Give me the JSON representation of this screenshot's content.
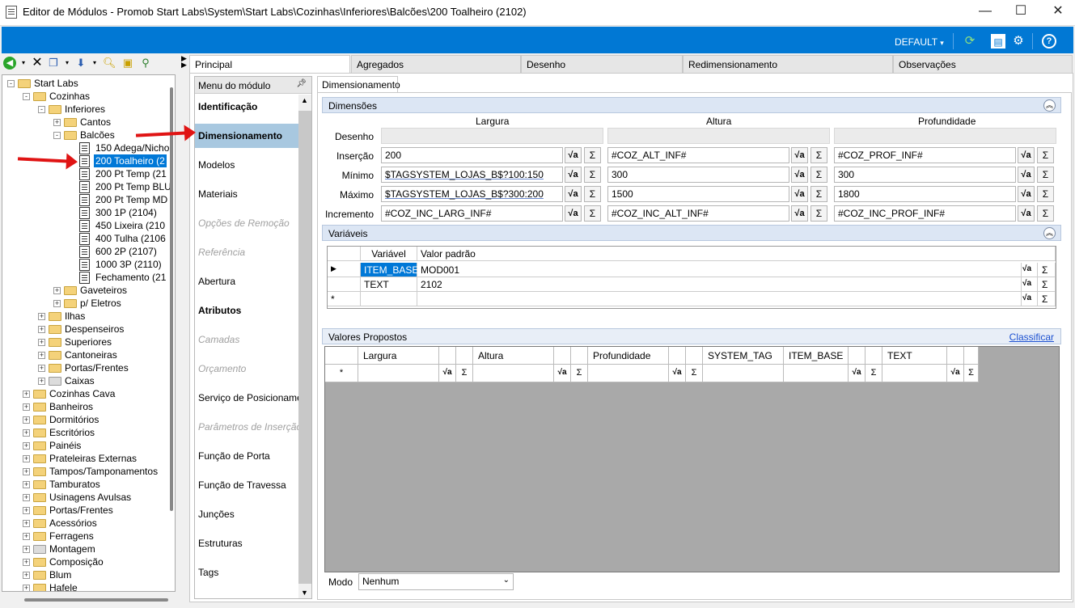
{
  "window": {
    "title": "Editor de Módulos - Promob Start Labs\\System\\Start Labs\\Cozinhas\\Inferiores\\Balcões\\200 Toalheiro (2102)",
    "minimize": "—",
    "maximize": "☐",
    "close": "✕"
  },
  "toolbar": {
    "profile_label": "DEFAULT",
    "profile_caret": "▾",
    "icons": [
      "refresh-icon",
      "panel-icon",
      "gears-icon",
      "help-icon"
    ]
  },
  "left_toolbar": {
    "icons": [
      "back-icon",
      "delete-icon",
      "copy-icon",
      "move-down-icon",
      "find-icon",
      "tree-icon"
    ]
  },
  "tree": {
    "items": [
      {
        "label": "Start Labs",
        "level": 0,
        "expander": "-",
        "kind": "folder"
      },
      {
        "label": "Cozinhas",
        "level": 1,
        "expander": "-",
        "kind": "folder"
      },
      {
        "label": "Inferiores",
        "level": 2,
        "expander": "-",
        "kind": "folder"
      },
      {
        "label": "Cantos",
        "level": 3,
        "expander": "+",
        "kind": "folder"
      },
      {
        "label": "Balcões",
        "level": 3,
        "expander": "-",
        "kind": "folder"
      },
      {
        "label": "150 Adega/Nicho",
        "level": 4,
        "expander": "",
        "kind": "doc"
      },
      {
        "label": "200 Toalheiro (2",
        "level": 4,
        "expander": "",
        "kind": "doc",
        "selected": true
      },
      {
        "label": "200 Pt Temp (21",
        "level": 4,
        "expander": "",
        "kind": "doc"
      },
      {
        "label": "200 Pt Temp BLU",
        "level": 4,
        "expander": "",
        "kind": "doc"
      },
      {
        "label": "200 Pt Temp MD",
        "level": 4,
        "expander": "",
        "kind": "doc"
      },
      {
        "label": "300 1P (2104)",
        "level": 4,
        "expander": "",
        "kind": "doc"
      },
      {
        "label": "450 Lixeira (210",
        "level": 4,
        "expander": "",
        "kind": "doc"
      },
      {
        "label": "400 Tulha (2106",
        "level": 4,
        "expander": "",
        "kind": "doc"
      },
      {
        "label": "600 2P (2107)",
        "level": 4,
        "expander": "",
        "kind": "doc"
      },
      {
        "label": "1000 3P (2110)",
        "level": 4,
        "expander": "",
        "kind": "doc"
      },
      {
        "label": "Fechamento (21",
        "level": 4,
        "expander": "",
        "kind": "doc"
      },
      {
        "label": "Gaveteiros",
        "level": 3,
        "expander": "+",
        "kind": "folder"
      },
      {
        "label": "p/ Eletros",
        "level": 3,
        "expander": "+",
        "kind": "folder"
      },
      {
        "label": "Ilhas",
        "level": 2,
        "expander": "+",
        "kind": "folder"
      },
      {
        "label": "Despenseiros",
        "level": 2,
        "expander": "+",
        "kind": "folder"
      },
      {
        "label": "Superiores",
        "level": 2,
        "expander": "+",
        "kind": "folder"
      },
      {
        "label": "Cantoneiras",
        "level": 2,
        "expander": "+",
        "kind": "folder"
      },
      {
        "label": "Portas/Frentes",
        "level": 2,
        "expander": "+",
        "kind": "folder"
      },
      {
        "label": "Caixas",
        "level": 2,
        "expander": "+",
        "kind": "folder-gray"
      },
      {
        "label": "Cozinhas Cava",
        "level": 1,
        "expander": "+",
        "kind": "folder"
      },
      {
        "label": "Banheiros",
        "level": 1,
        "expander": "+",
        "kind": "folder"
      },
      {
        "label": "Dormitórios",
        "level": 1,
        "expander": "+",
        "kind": "folder"
      },
      {
        "label": "Escritórios",
        "level": 1,
        "expander": "+",
        "kind": "folder"
      },
      {
        "label": "Painéis",
        "level": 1,
        "expander": "+",
        "kind": "folder"
      },
      {
        "label": "Prateleiras Externas",
        "level": 1,
        "expander": "+",
        "kind": "folder"
      },
      {
        "label": "Tampos/Tamponamentos",
        "level": 1,
        "expander": "+",
        "kind": "folder"
      },
      {
        "label": "Tamburatos",
        "level": 1,
        "expander": "+",
        "kind": "folder"
      },
      {
        "label": "Usinagens Avulsas",
        "level": 1,
        "expander": "+",
        "kind": "folder"
      },
      {
        "label": "Portas/Frentes",
        "level": 1,
        "expander": "+",
        "kind": "folder"
      },
      {
        "label": "Acessórios",
        "level": 1,
        "expander": "+",
        "kind": "folder"
      },
      {
        "label": "Ferragens",
        "level": 1,
        "expander": "+",
        "kind": "folder"
      },
      {
        "label": "Montagem",
        "level": 1,
        "expander": "+",
        "kind": "folder-gray"
      },
      {
        "label": "Composição",
        "level": 1,
        "expander": "+",
        "kind": "folder"
      },
      {
        "label": "Blum",
        "level": 1,
        "expander": "+",
        "kind": "folder"
      },
      {
        "label": "Hafele",
        "level": 1,
        "expander": "+",
        "kind": "folder"
      }
    ]
  },
  "tabs": [
    "Principal",
    "Agregados",
    "Desenho",
    "Redimensionamento",
    "Observações"
  ],
  "menu": {
    "title": "Menu do módulo",
    "items": [
      {
        "label": "Identificação",
        "style": "bold"
      },
      {
        "label": "Dimensionamento",
        "style": "selected"
      },
      {
        "label": "Modelos",
        "style": "normal"
      },
      {
        "label": "Materiais",
        "style": "normal"
      },
      {
        "label": "Opções de Remoção",
        "style": "disabled"
      },
      {
        "label": "Referência",
        "style": "disabled"
      },
      {
        "label": "Abertura",
        "style": "normal"
      },
      {
        "label": "Atributos",
        "style": "bold"
      },
      {
        "label": "Camadas",
        "style": "disabled"
      },
      {
        "label": "Orçamento",
        "style": "disabled"
      },
      {
        "label": "Serviço de Posicionamento",
        "style": "normal"
      },
      {
        "label": "Parâmetros de Inserção",
        "style": "disabled"
      },
      {
        "label": "Função de Porta",
        "style": "normal"
      },
      {
        "label": "Função de Travessa",
        "style": "normal"
      },
      {
        "label": "Junções",
        "style": "normal"
      },
      {
        "label": "Estruturas",
        "style": "normal"
      },
      {
        "label": "Tags",
        "style": "normal"
      }
    ]
  },
  "subtab": "Dimensionamento",
  "dimensoes": {
    "title": "Dimensões",
    "columns": [
      "Largura",
      "Altura",
      "Profundidade"
    ],
    "rows": [
      {
        "label": "Desenho",
        "values": [
          "",
          "",
          ""
        ],
        "disabled": true
      },
      {
        "label": "Inserção",
        "values": [
          "200",
          "#COZ_ALT_INF#",
          "#COZ_PROF_INF#"
        ]
      },
      {
        "label": "Mínimo",
        "values": [
          "$TAGSYSTEM_LOJAS_B$?100:150",
          "300",
          "300"
        ]
      },
      {
        "label": "Máximo",
        "values": [
          "$TAGSYSTEM_LOJAS_B$?300:200",
          "1500",
          "1800"
        ]
      },
      {
        "label": "Incremento",
        "values": [
          "#COZ_INC_LARG_INF#",
          "#COZ_INC_ALT_INF#",
          "#COZ_INC_PROF_INF#"
        ]
      }
    ],
    "formula_btn": "√a",
    "sum_btn": "Σ"
  },
  "variaveis": {
    "title": "Variáveis",
    "headers": [
      "Variável",
      "Valor padrão"
    ],
    "rows": [
      {
        "name": "ITEM_BASE",
        "value": "MOD001"
      },
      {
        "name": "TEXT",
        "value": "2102"
      }
    ],
    "row_pointer": "▶",
    "new_row_marker": "*"
  },
  "valores": {
    "title": "Valores Propostos",
    "classify_link": "Classificar",
    "headers": [
      "Largura",
      "Altura",
      "Profundidade",
      "SYSTEM_TAG",
      "ITEM_BASE",
      "TEXT"
    ],
    "new_row_marker": "*"
  },
  "modo": {
    "label": "Modo",
    "value": "Nenhum"
  }
}
